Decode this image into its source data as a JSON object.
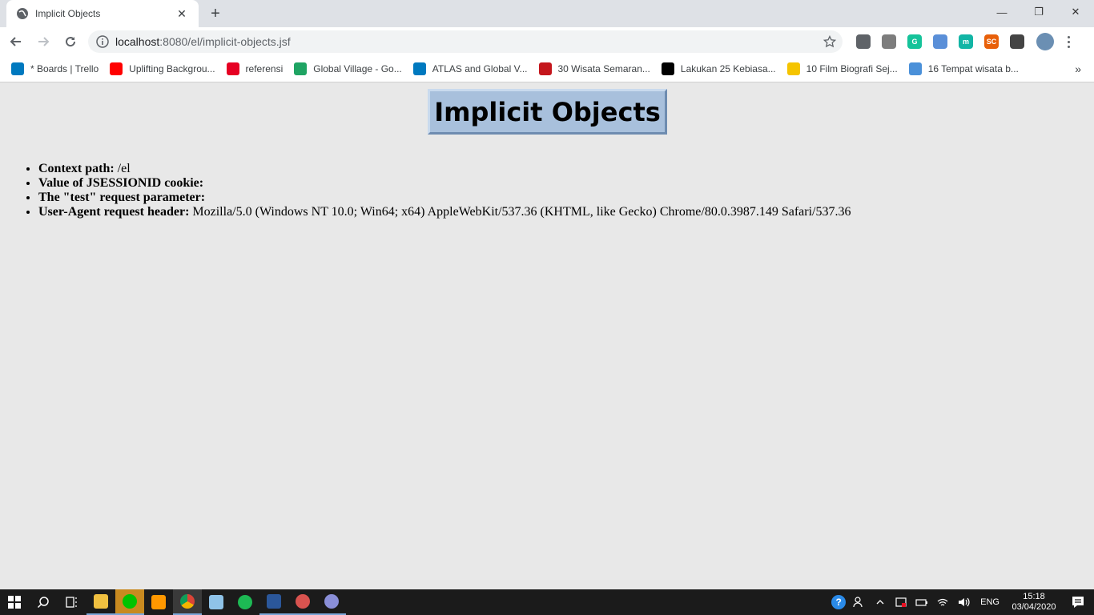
{
  "tab": {
    "title": "Implicit Objects"
  },
  "window_controls": {
    "minimize": "—",
    "restore": "❐",
    "close": "✕"
  },
  "address": {
    "host": "localhost",
    "rest": ":8080/el/implicit-objects.jsf"
  },
  "bookmarks": [
    {
      "label": "* Boards | Trello",
      "icon": "trello-icon",
      "color": "#0079bf"
    },
    {
      "label": "Uplifting Backgrou...",
      "icon": "youtube-icon",
      "color": "#ff0000"
    },
    {
      "label": "referensi",
      "icon": "pinterest-icon",
      "color": "#e60023"
    },
    {
      "label": "Global Village - Go...",
      "icon": "google-drive-icon",
      "color": "#1fa463"
    },
    {
      "label": "ATLAS and Global V...",
      "icon": "trello-icon",
      "color": "#0079bf"
    },
    {
      "label": "30 Wisata Semaran...",
      "icon": "m-brand-icon",
      "color": "#c4161c"
    },
    {
      "label": "Lakukan 25 Kebiasa...",
      "icon": "m-black-icon",
      "color": "#000000"
    },
    {
      "label": "10 Film Biografi Sej...",
      "icon": "z-brand-icon",
      "color": "#f5c400"
    },
    {
      "label": "16 Tempat wisata b...",
      "icon": "bird-icon",
      "color": "#4a90d9"
    }
  ],
  "page": {
    "heading": "Implicit Objects",
    "items": [
      {
        "label": "Context path:",
        "value": " /el"
      },
      {
        "label": "Value of JSESSIONID cookie:",
        "value": ""
      },
      {
        "label": "The \"test\" request parameter:",
        "value": ""
      },
      {
        "label": "User-Agent request header:",
        "value": " Mozilla/5.0 (Windows NT 10.0; Win64; x64) AppleWebKit/537.36 (KHTML, like Gecko) Chrome/80.0.3987.149 Safari/537.36"
      }
    ]
  },
  "extensions": [
    {
      "name": "ext-message-icon",
      "color": "#5f6368",
      "text": ""
    },
    {
      "name": "ext-cube-icon",
      "color": "#7d7d7d",
      "text": ""
    },
    {
      "name": "grammarly-icon",
      "color": "#15c39a",
      "text": "G"
    },
    {
      "name": "ext-feather-icon",
      "color": "#5a8fd8",
      "text": ""
    },
    {
      "name": "ext-m-icon",
      "color": "#12b5a5",
      "text": "m"
    },
    {
      "name": "ext-sc-icon",
      "color": "#e8600a",
      "text": "SC"
    },
    {
      "name": "ext-circle-icon",
      "color": "#444444",
      "text": ""
    }
  ],
  "taskbar": {
    "lang": "ENG",
    "time": "15:18",
    "date": "03/04/2020"
  }
}
